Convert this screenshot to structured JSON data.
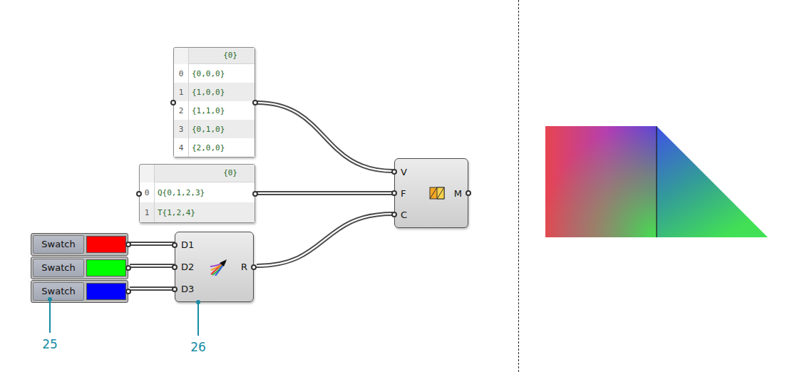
{
  "points_panel": {
    "header": "{0}",
    "rows": [
      {
        "index": "0",
        "value": "{0,0,0}"
      },
      {
        "index": "1",
        "value": "{1,0,0}"
      },
      {
        "index": "2",
        "value": "{1,1,0}"
      },
      {
        "index": "3",
        "value": "{0,1,0}"
      },
      {
        "index": "4",
        "value": "{2,0,0}"
      }
    ]
  },
  "faces_panel": {
    "header": "{0}",
    "rows": [
      {
        "index": "0",
        "value": "Q{0,1,2,3}"
      },
      {
        "index": "1",
        "value": "T{1,2,4}"
      }
    ]
  },
  "mesh_component": {
    "inputs": [
      "V",
      "F",
      "C"
    ],
    "outputs": [
      "M"
    ]
  },
  "gradient_component": {
    "inputs": [
      "D1",
      "D2",
      "D3"
    ],
    "outputs": [
      "R"
    ]
  },
  "swatches": [
    {
      "label": "Swatch",
      "color": "#ff0000"
    },
    {
      "label": "Swatch",
      "color": "#00ff00"
    },
    {
      "label": "Swatch",
      "color": "#0000ff"
    }
  ],
  "callouts": [
    {
      "label": "25"
    },
    {
      "label": "26"
    }
  ]
}
